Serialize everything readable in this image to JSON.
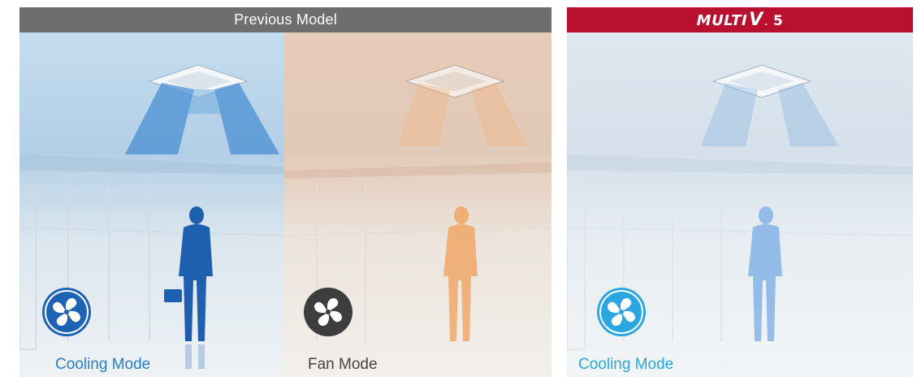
{
  "comparison": {
    "previous_model": {
      "header_title": "Previous Model",
      "panels": [
        {
          "mode_label": "Cooling Mode",
          "icon": "cooling-fan-icon",
          "color": "#2a7fcb"
        },
        {
          "mode_label": "Fan Mode",
          "icon": "fan-icon",
          "color": "#444444"
        }
      ]
    },
    "new_model": {
      "brand_text": "MULTI",
      "brand_v": "V",
      "brand_dot": ".",
      "brand_num": "5",
      "header_color": "#b8102e",
      "panels": [
        {
          "mode_label": "Cooling Mode",
          "icon": "cooling-fan-icon",
          "color": "#2aa7e0"
        }
      ]
    }
  }
}
